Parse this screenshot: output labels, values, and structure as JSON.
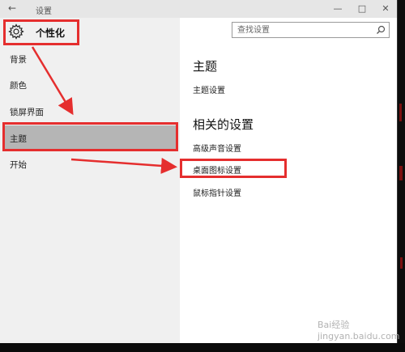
{
  "titlebar": {
    "back_icon": "←",
    "title": "设置",
    "minimize_icon": "—",
    "maximize_icon": "□",
    "close_icon": "✕"
  },
  "sidebar": {
    "header": {
      "icon": "gear-icon",
      "label": "个性化"
    },
    "items": [
      {
        "label": "背景"
      },
      {
        "label": "颜色"
      },
      {
        "label": "锁屏界面"
      },
      {
        "label": "主题",
        "selected": true
      },
      {
        "label": "开始"
      }
    ]
  },
  "search": {
    "placeholder": "查找设置",
    "icon": "search-icon"
  },
  "main": {
    "section_title": "主题",
    "theme_settings_link": "主题设置",
    "related_title": "相关的设置",
    "related_links": [
      {
        "label": "高级声音设置"
      },
      {
        "label": "桌面图标设置"
      },
      {
        "label": "鼠标指针设置"
      }
    ]
  },
  "annotations": {
    "color": "#e52e2e"
  },
  "watermark": {
    "text": "Bai经验 jingyan.baidu.com"
  }
}
